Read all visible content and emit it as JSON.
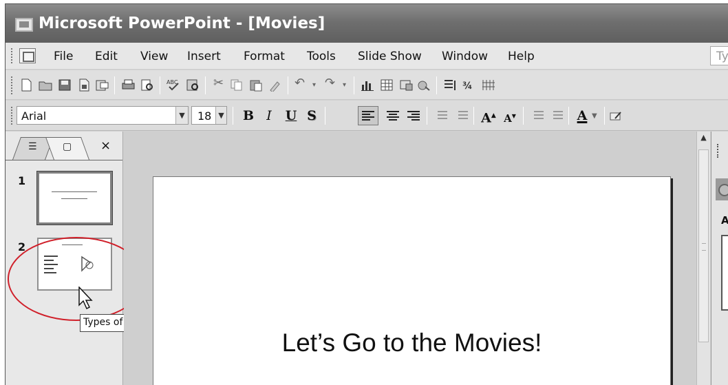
{
  "window": {
    "title": "Microsoft PowerPoint - [Movies]"
  },
  "menubar": {
    "items": [
      "File",
      "Edit",
      "View",
      "Insert",
      "Format",
      "Tools",
      "Slide Show",
      "Window",
      "Help"
    ],
    "ask_placeholder": "Ty"
  },
  "toolbar_standard": {
    "icons": [
      "new-icon",
      "open-icon",
      "save-icon",
      "permission-icon",
      "email-icon",
      "print-icon",
      "print-preview-icon",
      "spelling-icon",
      "research-icon",
      "cut-icon",
      "copy-icon",
      "paste-icon",
      "format-painter-icon",
      "undo-icon",
      "redo-icon",
      "insert-chart-icon",
      "insert-table-icon",
      "tables-borders-icon",
      "hyperlink-icon",
      "expand-icon",
      "show-formatting-icon",
      "grid-icon"
    ]
  },
  "toolbar_formatting": {
    "font": "Arial",
    "font_size": "18",
    "bold": "B",
    "italic": "I",
    "underline": "U",
    "shadow": "S",
    "font_color": "A",
    "grow_font": "A",
    "shrink_font": "A"
  },
  "left_pane": {
    "close_glyph": "×",
    "slides": [
      {
        "number": "1"
      },
      {
        "number": "2"
      }
    ],
    "tooltip": "Types of Movies"
  },
  "slide": {
    "title": "Let’s Go to the Movies!"
  },
  "task_pane": {
    "label": "A"
  },
  "colors": {
    "highlight": "#d0202a",
    "titlebar": "#6f6f6f"
  }
}
